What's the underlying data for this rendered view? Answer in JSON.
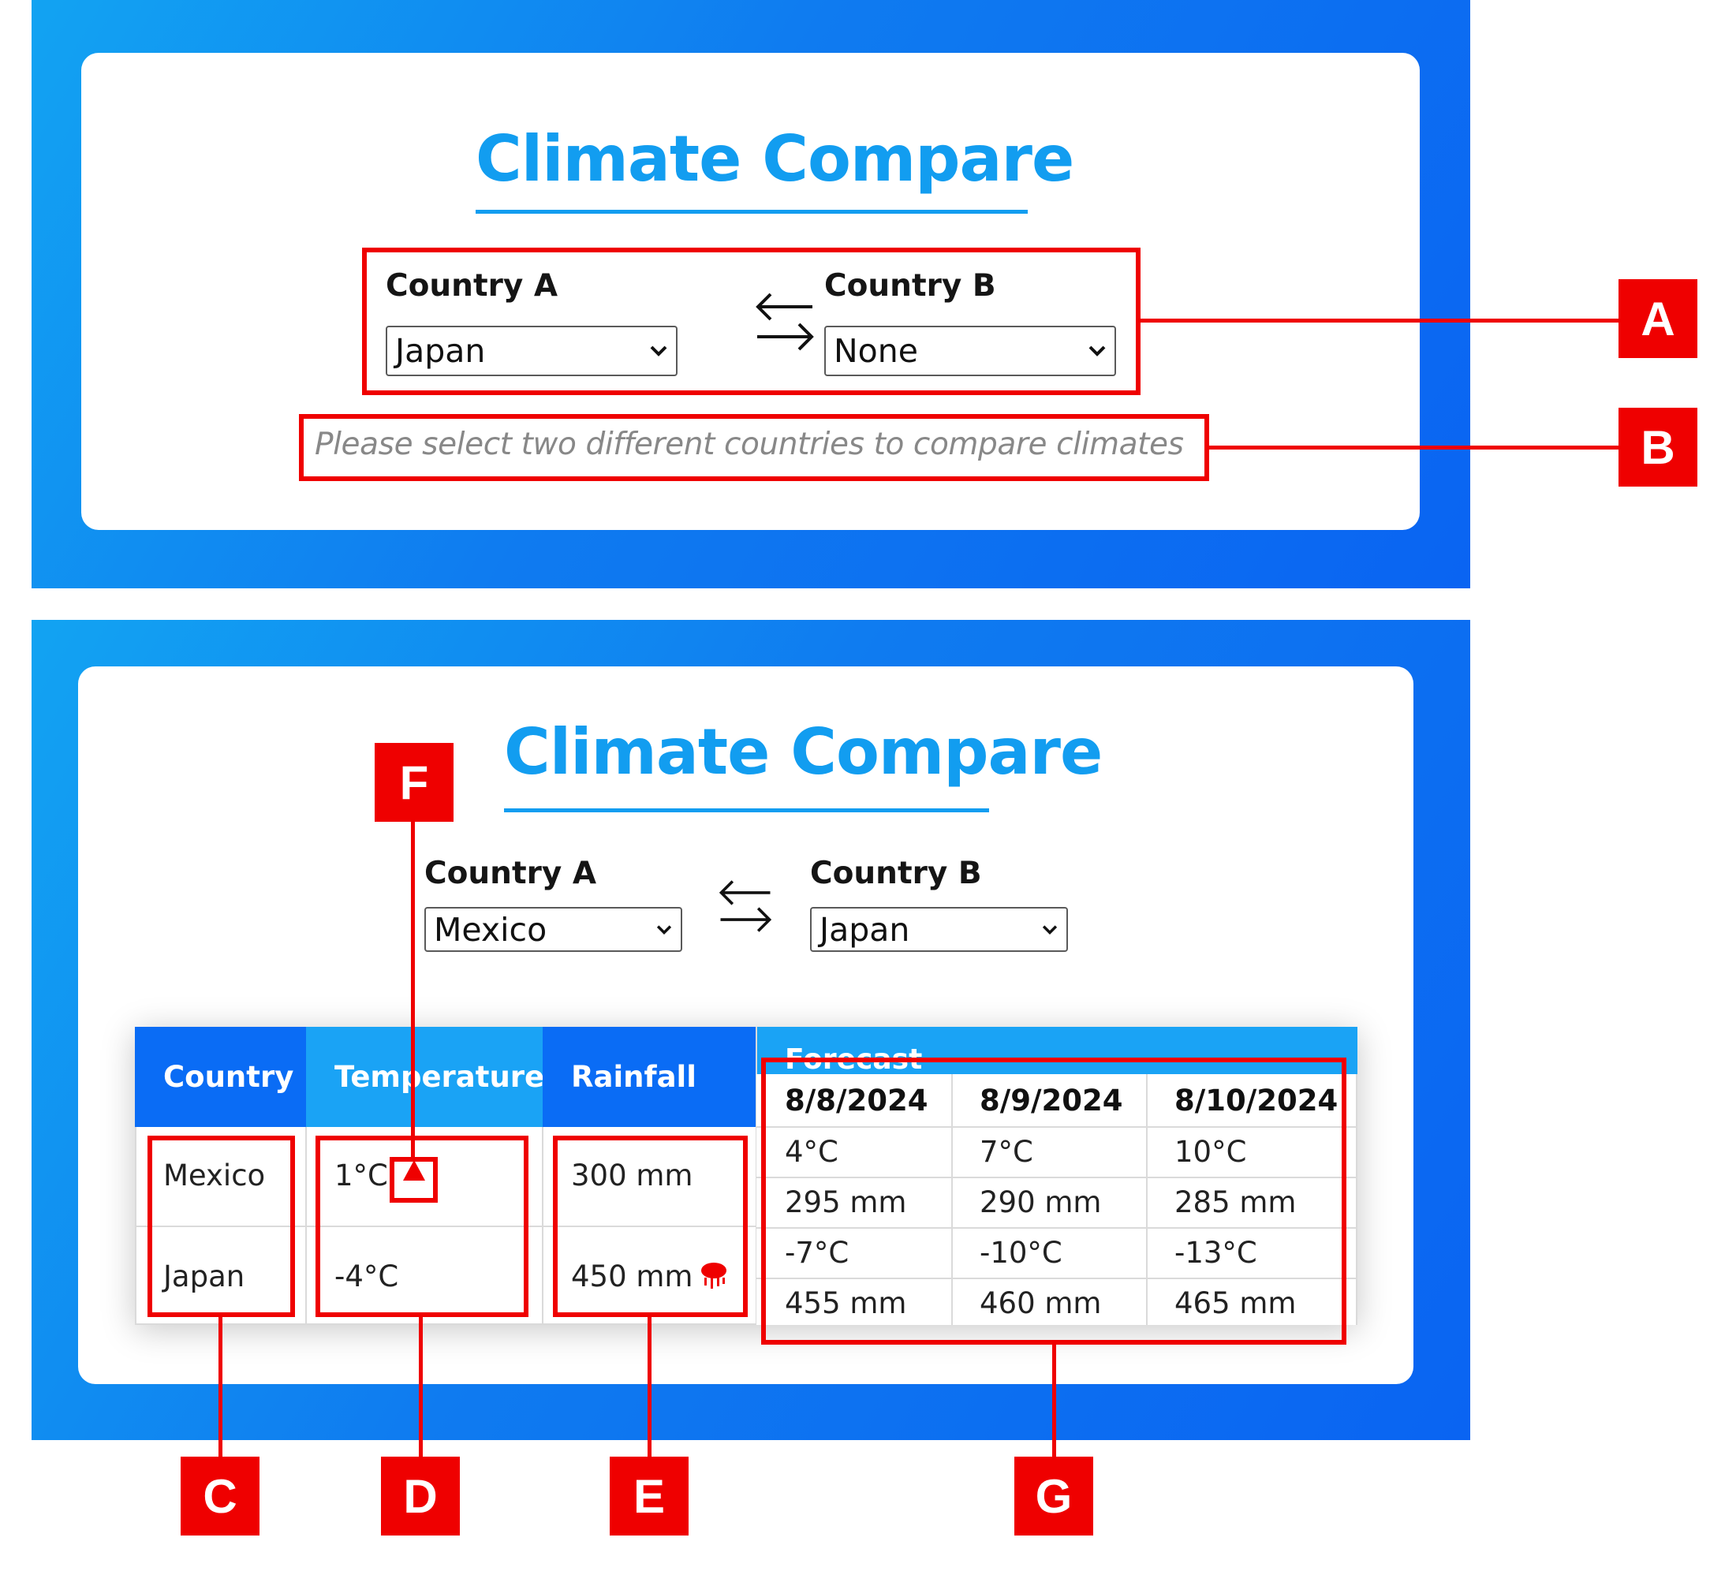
{
  "app": {
    "title": "Climate Compare"
  },
  "screen_before": {
    "country_a": {
      "label": "Country A",
      "value": "Japan"
    },
    "country_b": {
      "label": "Country B",
      "value": "None"
    },
    "message": "Please select two different countries to compare climates"
  },
  "screen_after": {
    "country_a": {
      "label": "Country A",
      "value": "Mexico"
    },
    "country_b": {
      "label": "Country B",
      "value": "Japan"
    },
    "table": {
      "headers": {
        "country": "Country",
        "temperature": "Temperature",
        "rainfall": "Rainfall",
        "forecast": "Forecast"
      },
      "rows": [
        {
          "country": "Mexico",
          "temperature": "1°C",
          "rainfall": "300 mm",
          "temp_icon": "warning-triangle-icon"
        },
        {
          "country": "Japan",
          "temperature": "-4°C",
          "rainfall": "450 mm",
          "rain_icon": "rain-cloud-icon"
        }
      ],
      "forecast": {
        "dates": [
          "8/8/2024",
          "8/9/2024",
          "8/10/2024"
        ],
        "rows": [
          [
            "4°C",
            "7°C",
            "10°C"
          ],
          [
            "295 mm",
            "290 mm",
            "285 mm"
          ],
          [
            "-7°C",
            "-10°C",
            "-13°C"
          ],
          [
            "455 mm",
            "460 mm",
            "465 mm"
          ]
        ]
      }
    }
  },
  "annotations": [
    "A",
    "B",
    "C",
    "D",
    "E",
    "F",
    "G"
  ],
  "colors": {
    "accent": "#129df0",
    "header_dark": "#0a6cf5",
    "header_light": "#1aa3f5",
    "annotation": "#ef0000"
  }
}
